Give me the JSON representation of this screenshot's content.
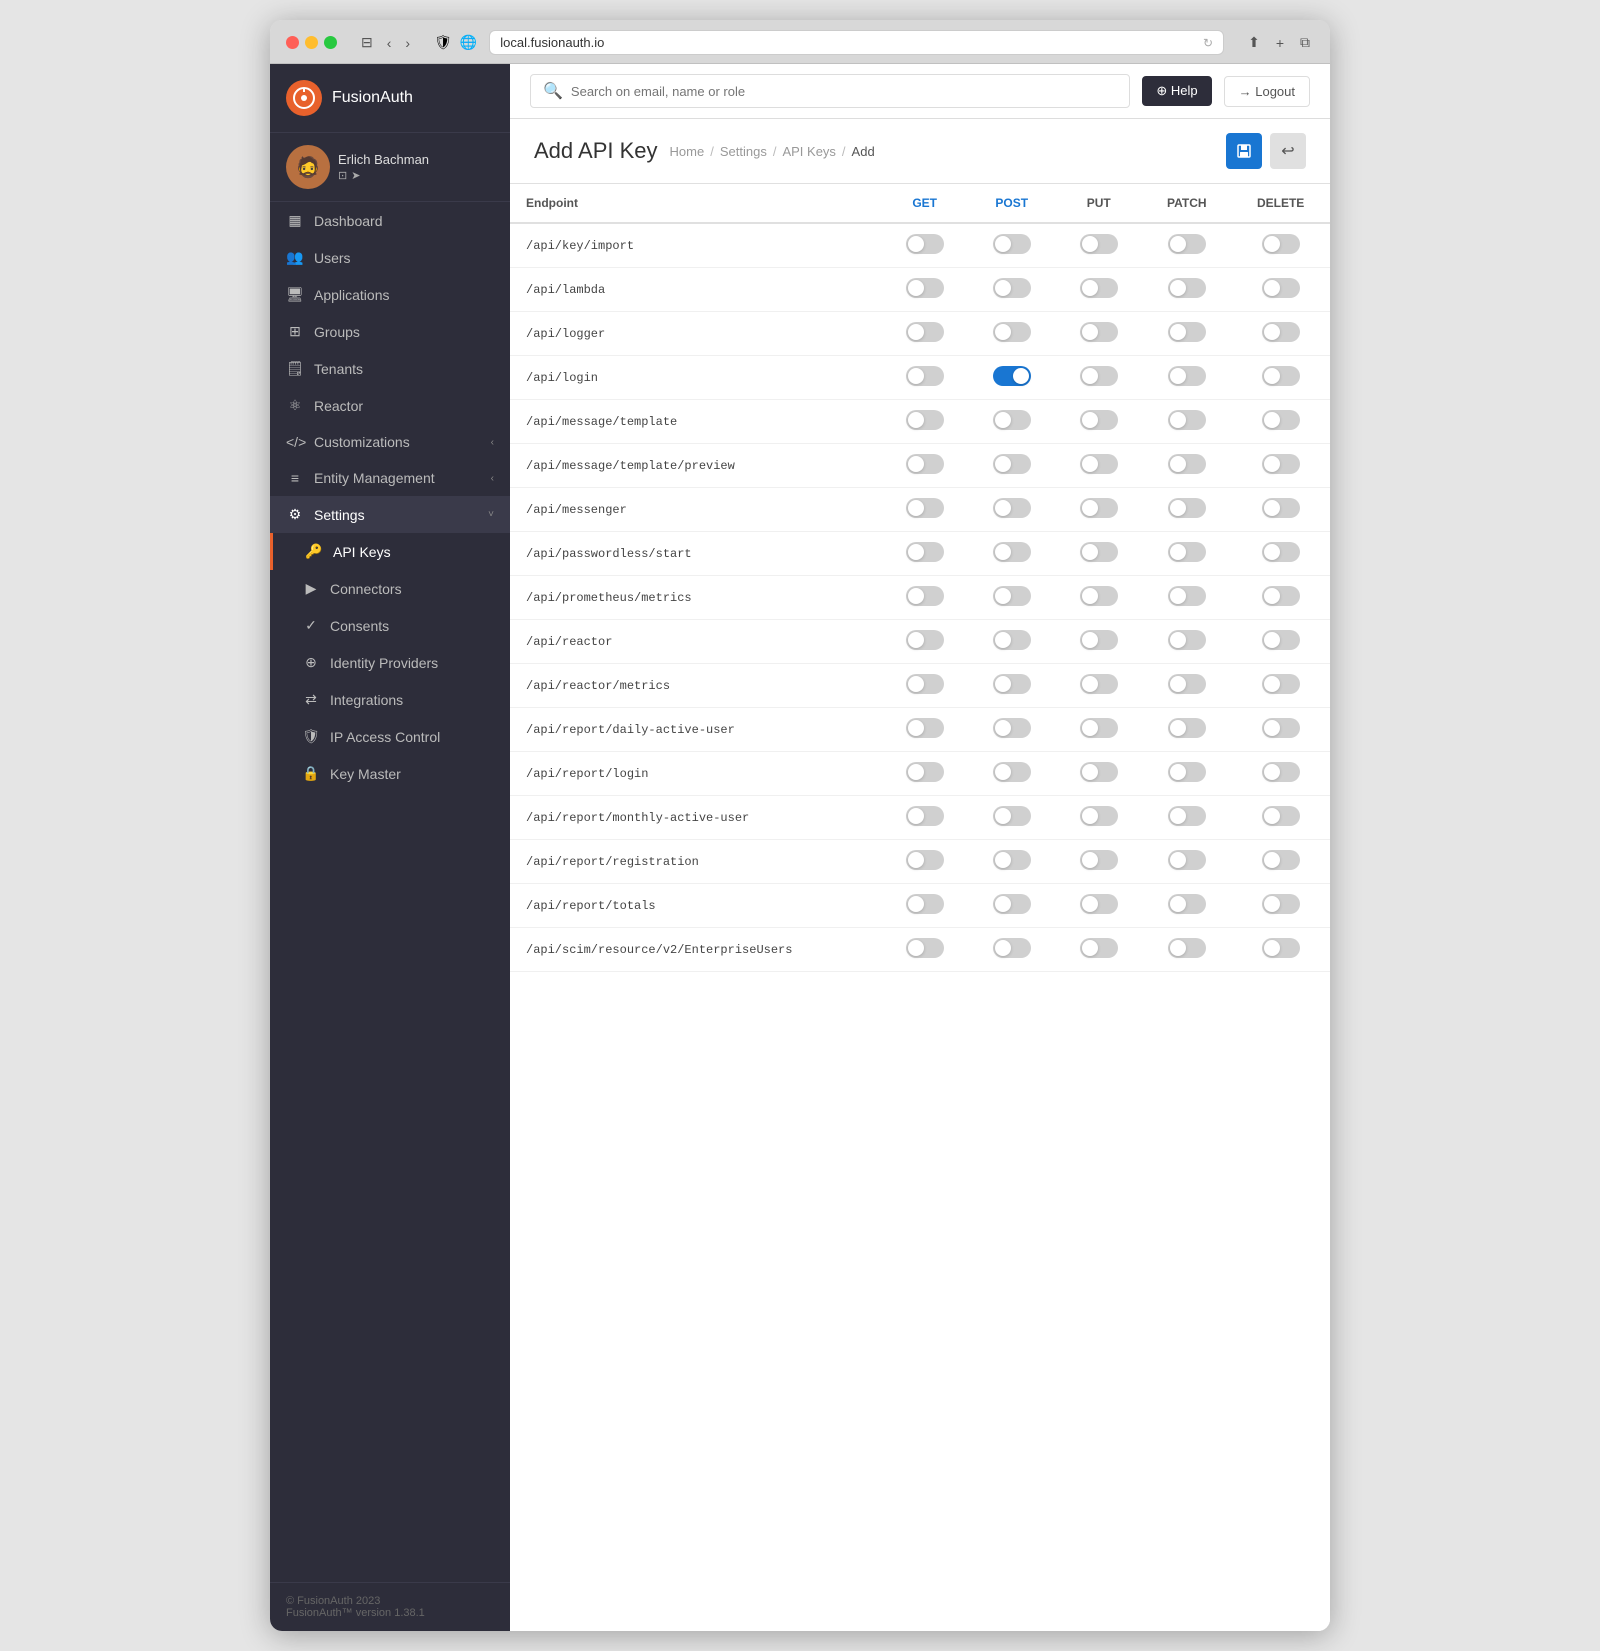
{
  "browser": {
    "url": "local.fusionauth.io",
    "reload_icon": "↻"
  },
  "topbar": {
    "search_placeholder": "Search on email, name or role",
    "help_label": "⊕ Help",
    "logout_label": "→ Logout"
  },
  "page": {
    "title": "Add API Key",
    "breadcrumb": [
      "Home",
      "Settings",
      "API Keys",
      "Add"
    ],
    "action_save": "💾",
    "action_back": "↩"
  },
  "table": {
    "columns": [
      "Endpoint",
      "GET",
      "POST",
      "PUT",
      "PATCH",
      "DELETE"
    ],
    "rows": [
      {
        "endpoint": "/api/key/import",
        "get": false,
        "post": false,
        "put": false,
        "patch": false,
        "delete": false
      },
      {
        "endpoint": "/api/lambda",
        "get": false,
        "post": false,
        "put": false,
        "patch": false,
        "delete": false
      },
      {
        "endpoint": "/api/logger",
        "get": false,
        "post": false,
        "put": false,
        "patch": false,
        "delete": false
      },
      {
        "endpoint": "/api/login",
        "get": false,
        "post": true,
        "put": false,
        "patch": false,
        "delete": false
      },
      {
        "endpoint": "/api/message/template",
        "get": false,
        "post": false,
        "put": false,
        "patch": false,
        "delete": false
      },
      {
        "endpoint": "/api/message/template/preview",
        "get": false,
        "post": false,
        "put": false,
        "patch": false,
        "delete": false
      },
      {
        "endpoint": "/api/messenger",
        "get": false,
        "post": false,
        "put": false,
        "patch": false,
        "delete": false
      },
      {
        "endpoint": "/api/passwordless/start",
        "get": false,
        "post": false,
        "put": false,
        "patch": false,
        "delete": false
      },
      {
        "endpoint": "/api/prometheus/metrics",
        "get": false,
        "post": false,
        "put": false,
        "patch": false,
        "delete": false
      },
      {
        "endpoint": "/api/reactor",
        "get": false,
        "post": false,
        "put": false,
        "patch": false,
        "delete": false
      },
      {
        "endpoint": "/api/reactor/metrics",
        "get": false,
        "post": false,
        "put": false,
        "patch": false,
        "delete": false
      },
      {
        "endpoint": "/api/report/daily-active-user",
        "get": false,
        "post": false,
        "put": false,
        "patch": false,
        "delete": false
      },
      {
        "endpoint": "/api/report/login",
        "get": false,
        "post": false,
        "put": false,
        "patch": false,
        "delete": false
      },
      {
        "endpoint": "/api/report/monthly-active-user",
        "get": false,
        "post": false,
        "put": false,
        "patch": false,
        "delete": false
      },
      {
        "endpoint": "/api/report/registration",
        "get": false,
        "post": false,
        "put": false,
        "patch": false,
        "delete": false
      },
      {
        "endpoint": "/api/report/totals",
        "get": false,
        "post": false,
        "put": false,
        "patch": false,
        "delete": false
      },
      {
        "endpoint": "/api/scim/resource/v2/EnterpriseUsers",
        "get": false,
        "post": false,
        "put": false,
        "patch": false,
        "delete": false
      }
    ]
  },
  "sidebar": {
    "brand_name": "FusionAuth",
    "user_name": "Erlich Bachman",
    "nav_items": [
      {
        "id": "dashboard",
        "label": "Dashboard",
        "icon": "▦",
        "sub": false,
        "active": false
      },
      {
        "id": "users",
        "label": "Users",
        "icon": "👥",
        "sub": false,
        "active": false
      },
      {
        "id": "applications",
        "label": "Applications",
        "icon": "🖥",
        "sub": false,
        "active": false
      },
      {
        "id": "groups",
        "label": "Groups",
        "icon": "⊞",
        "sub": false,
        "active": false
      },
      {
        "id": "tenants",
        "label": "Tenants",
        "icon": "🗒",
        "sub": false,
        "active": false
      },
      {
        "id": "reactor",
        "label": "Reactor",
        "icon": "⚛",
        "sub": false,
        "active": false
      },
      {
        "id": "customizations",
        "label": "Customizations",
        "icon": "</>",
        "sub": false,
        "active": false,
        "chevron": "‹"
      },
      {
        "id": "entity-mgmt",
        "label": "Entity Management",
        "icon": "≡",
        "sub": false,
        "active": false,
        "chevron": "‹"
      },
      {
        "id": "settings",
        "label": "Settings",
        "icon": "⚙",
        "sub": false,
        "active": true,
        "chevron": "˅"
      },
      {
        "id": "api-keys",
        "label": "API Keys",
        "icon": "🔑",
        "sub": true,
        "active": true
      },
      {
        "id": "connectors",
        "label": "Connectors",
        "icon": "▶",
        "sub": true,
        "active": false
      },
      {
        "id": "consents",
        "label": "Consents",
        "icon": "✓",
        "sub": true,
        "active": false
      },
      {
        "id": "identity-providers",
        "label": "Identity Providers",
        "icon": "⊕",
        "sub": true,
        "active": false
      },
      {
        "id": "integrations",
        "label": "Integrations",
        "icon": "⇄",
        "sub": true,
        "active": false
      },
      {
        "id": "ip-access-control",
        "label": "IP Access Control",
        "icon": "🛡",
        "sub": true,
        "active": false
      },
      {
        "id": "key-master",
        "label": "Key Master",
        "icon": "🔒",
        "sub": true,
        "active": false
      }
    ],
    "footer": {
      "line1": "© FusionAuth 2023",
      "line2": "FusionAuth™ version 1.38.1"
    }
  }
}
